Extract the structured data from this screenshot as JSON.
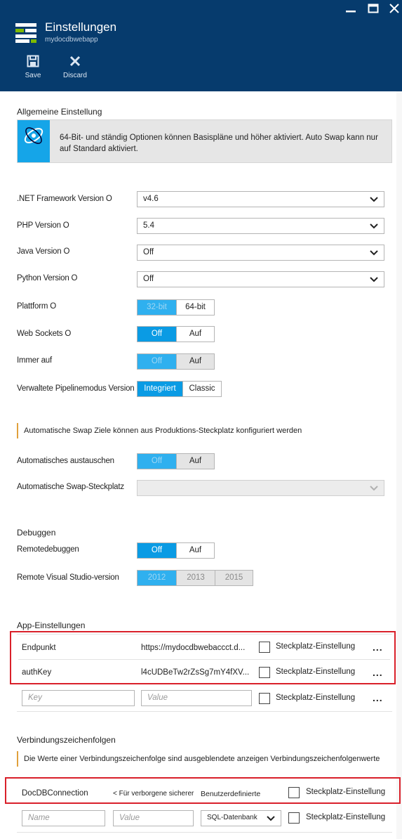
{
  "header": {
    "title": "Einstellungen",
    "subtitle": "mydocdbwebapp",
    "commands": [
      {
        "label": "Save",
        "icon": "save-icon"
      },
      {
        "label": "Discard",
        "icon": "close-icon"
      }
    ]
  },
  "general": {
    "title": "Allgemeine Einstellung",
    "info": "64-Bit- und ständig Optionen können Basispläne und höher aktiviert. Auto Swap kann nur auf Standard aktiviert.",
    "net": {
      "label": ".NET Framework Version O",
      "value": "v4.6"
    },
    "php": {
      "label": "PHP Version O",
      "value": "5.4"
    },
    "java": {
      "label": "Java Version O",
      "value": "Off"
    },
    "python": {
      "label": "Python Version O",
      "value": "Off"
    },
    "platform": {
      "label": "Plattform O",
      "options": [
        "32-bit",
        "64-bit"
      ]
    },
    "websockets": {
      "label": "Web Sockets O",
      "options": [
        "Off",
        "Auf"
      ]
    },
    "always_on": {
      "label": "Immer auf",
      "options": [
        "Off",
        "Auf"
      ]
    },
    "pipeline": {
      "label": "Verwaltete Pipelinemodus Version",
      "options": [
        "Integriert",
        "Classic"
      ]
    }
  },
  "swap": {
    "notice": "Automatische Swap Ziele können aus Produktions-Steckplatz konfiguriert werden",
    "auto": {
      "label": "Automatisches austauschen",
      "options": [
        "Off",
        "Auf"
      ]
    },
    "slot": {
      "label": "Automatische Swap-Steckplatz",
      "value": ""
    }
  },
  "debug": {
    "title": "Debuggen",
    "remote": {
      "label": "Remotedebuggen",
      "options": [
        "Off",
        "Auf"
      ]
    },
    "vs": {
      "label": "Remote Visual Studio-version",
      "options": [
        "2012",
        "2013",
        "2015"
      ]
    }
  },
  "app_settings": {
    "title": "App-Einstellungen",
    "rows": [
      {
        "key": "Endpunkt",
        "value": "https://mydocdbwebaccct.d...",
        "slot": "Steckplatz-Einstellung"
      },
      {
        "key": "authKey",
        "value": "l4cUDBeTw2rZsSg7mY4fXV...",
        "slot": "Steckplatz-Einstellung"
      }
    ],
    "new_row": {
      "key_placeholder": "Key",
      "value_placeholder": "Value",
      "slot": "Steckplatz-Einstellung"
    },
    "more": "..."
  },
  "connections": {
    "title": "Verbindungszeichenfolgen",
    "notice": "Die Werte einer Verbindungszeichenfolge sind ausgeblendete anzeigen Verbindungszeichenfolgenwerte",
    "row": {
      "name": "DocDBConnection",
      "value": "< Für verborgene sicherer",
      "type": "Benutzerdefinierte",
      "slot": "Steckplatz-Einstellung"
    },
    "new_row": {
      "name_placeholder": "Name",
      "value_placeholder": "Value",
      "type": "SQL-Datenbank",
      "slot": "Steckplatz-Einstellung"
    }
  },
  "colors": {
    "header": "#063b6d",
    "accent": "#0a9be4",
    "highlight": "#d9202a"
  }
}
